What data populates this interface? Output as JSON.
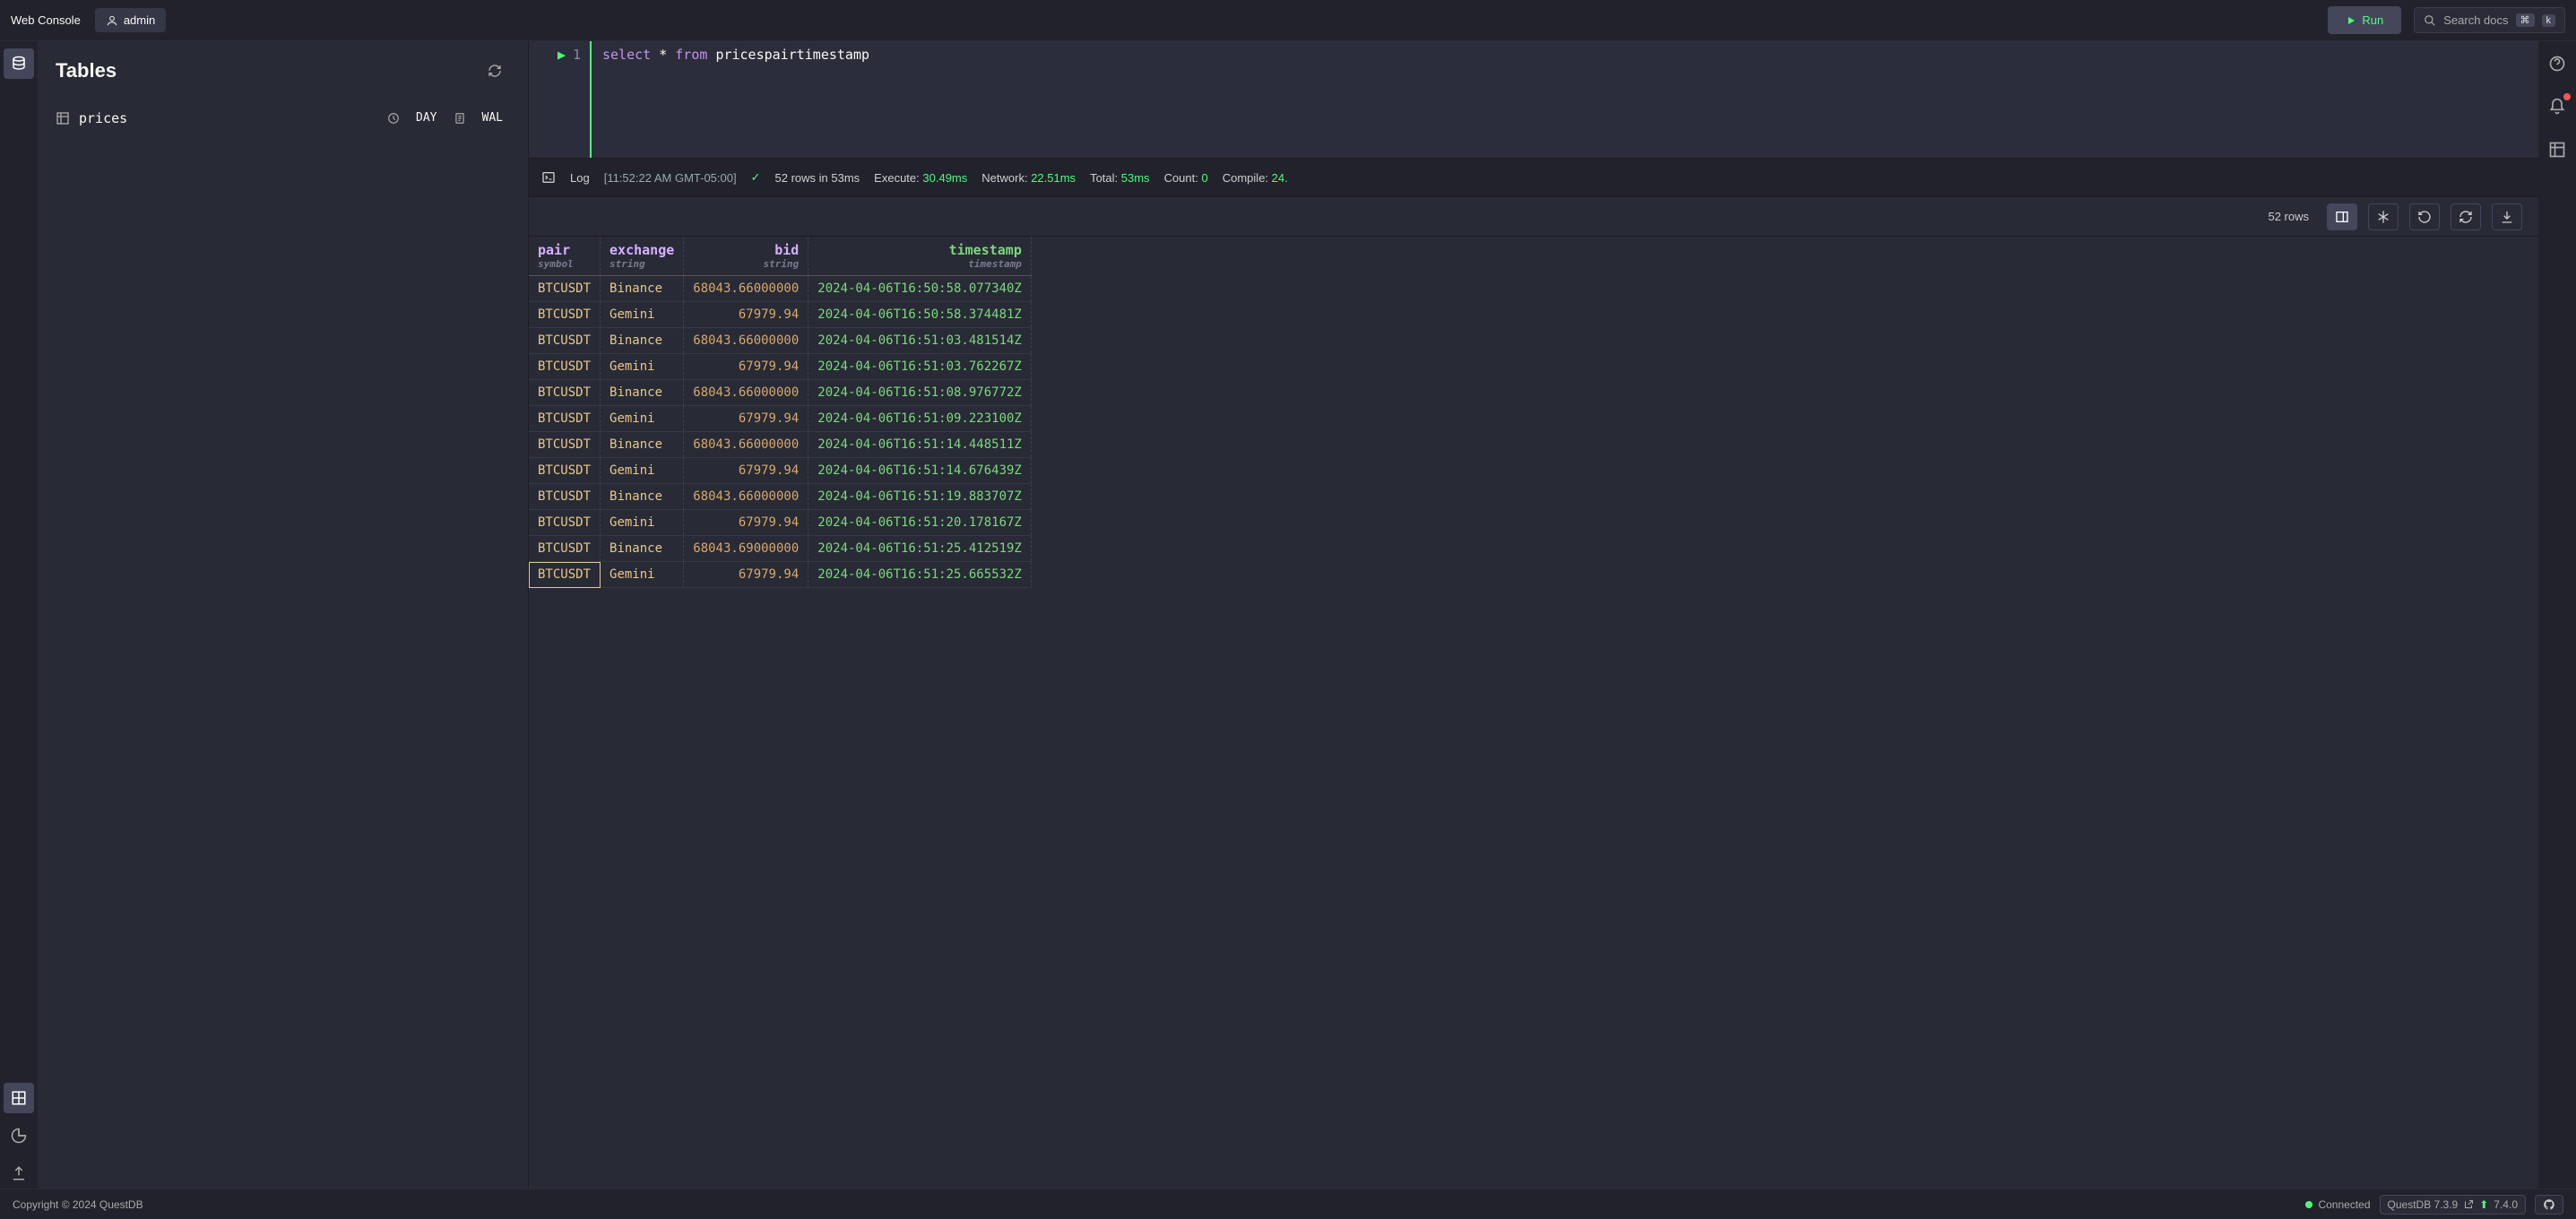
{
  "topbar": {
    "title": "Web Console",
    "user": "admin",
    "run_label": "Run",
    "search_placeholder": "Search docs",
    "kbd1": "⌘",
    "kbd2": "k"
  },
  "sidebar": {
    "heading": "Tables",
    "tables": [
      {
        "name": "prices",
        "partition": "DAY",
        "wal": "WAL"
      }
    ]
  },
  "editor": {
    "line_no": "1",
    "sql_kw1": "select",
    "sql_star": "*",
    "sql_kw2": "from",
    "sql_ident": "pricespairtimestamp"
  },
  "log": {
    "label": "Log",
    "timestamp": "[11:52:22 AM GMT-05:00]",
    "rowcount_text": "52 rows in 53ms",
    "execute_label": "Execute:",
    "execute_value": "30.49ms",
    "network_label": "Network:",
    "network_value": "22.51ms",
    "total_label": "Total:",
    "total_value": "53ms",
    "count_label": "Count:",
    "count_value": "0",
    "compile_label": "Compile:",
    "compile_value": "24."
  },
  "results": {
    "rows_label": "52 rows",
    "columns": [
      {
        "name": "pair",
        "type": "symbol"
      },
      {
        "name": "exchange",
        "type": "string"
      },
      {
        "name": "bid",
        "type": "string"
      },
      {
        "name": "timestamp",
        "type": "timestamp"
      }
    ],
    "rows": [
      [
        "BTCUSDT",
        "Binance",
        "68043.66000000",
        "2024-04-06T16:50:58.077340Z"
      ],
      [
        "BTCUSDT",
        "Gemini",
        "67979.94",
        "2024-04-06T16:50:58.374481Z"
      ],
      [
        "BTCUSDT",
        "Binance",
        "68043.66000000",
        "2024-04-06T16:51:03.481514Z"
      ],
      [
        "BTCUSDT",
        "Gemini",
        "67979.94",
        "2024-04-06T16:51:03.762267Z"
      ],
      [
        "BTCUSDT",
        "Binance",
        "68043.66000000",
        "2024-04-06T16:51:08.976772Z"
      ],
      [
        "BTCUSDT",
        "Gemini",
        "67979.94",
        "2024-04-06T16:51:09.223100Z"
      ],
      [
        "BTCUSDT",
        "Binance",
        "68043.66000000",
        "2024-04-06T16:51:14.448511Z"
      ],
      [
        "BTCUSDT",
        "Gemini",
        "67979.94",
        "2024-04-06T16:51:14.676439Z"
      ],
      [
        "BTCUSDT",
        "Binance",
        "68043.66000000",
        "2024-04-06T16:51:19.883707Z"
      ],
      [
        "BTCUSDT",
        "Gemini",
        "67979.94",
        "2024-04-06T16:51:20.178167Z"
      ],
      [
        "BTCUSDT",
        "Binance",
        "68043.69000000",
        "2024-04-06T16:51:25.412519Z"
      ],
      [
        "BTCUSDT",
        "Gemini",
        "67979.94",
        "2024-04-06T16:51:25.665532Z"
      ]
    ],
    "selected_row": 11
  },
  "footer": {
    "copyright": "Copyright © 2024 QuestDB",
    "connected": "Connected",
    "version_label": "QuestDB 7.3.9",
    "next_version": "7.4.0"
  }
}
